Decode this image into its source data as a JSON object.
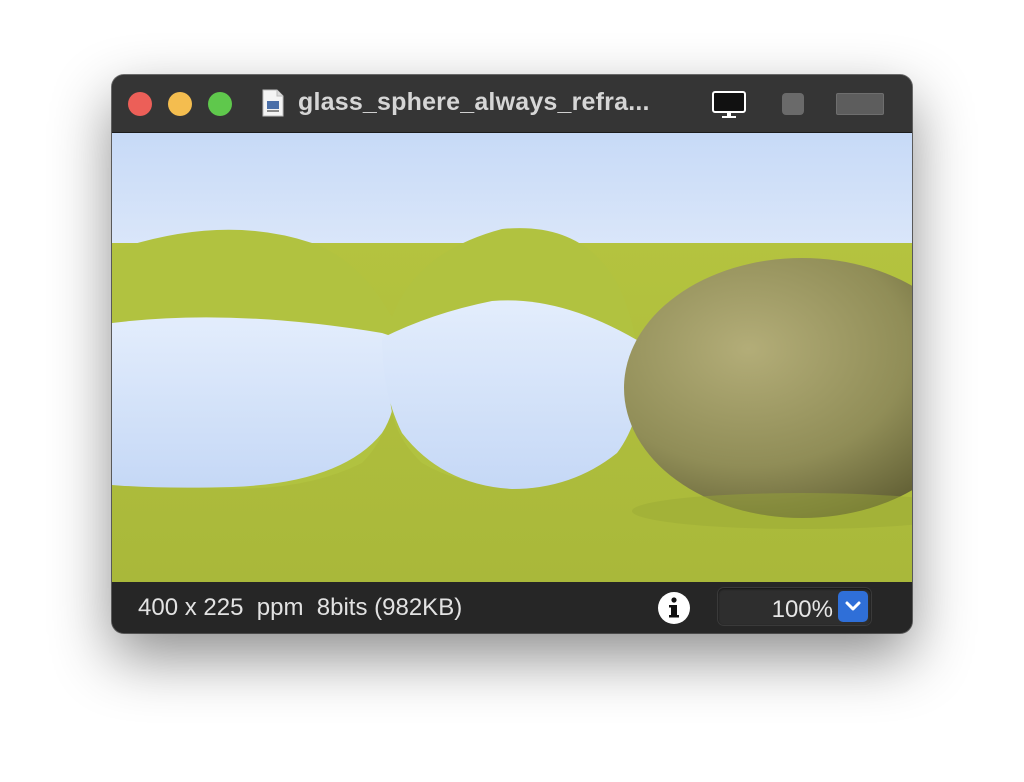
{
  "window": {
    "title": "glass_sphere_always_refra...",
    "buttons": {
      "close_color": "#ec5f58",
      "minimize_color": "#f4bd4f",
      "zoom_color": "#5fc84c"
    },
    "toolbar_icons": [
      "document-icon",
      "monitor-icon",
      "square-button-icon",
      "wide-button-icon"
    ]
  },
  "image": {
    "description_colors": {
      "sky": "#c9dcf7",
      "ground": "#b2c23f",
      "glass_highlight": "#deeafc",
      "matte_sphere": "#9c9a5e"
    }
  },
  "status": {
    "info_text": "400 x 225  ppm  8bits (982KB)",
    "zoom_value": "100%",
    "info_icon": "info-icon",
    "accent": "#2f6fd8"
  }
}
